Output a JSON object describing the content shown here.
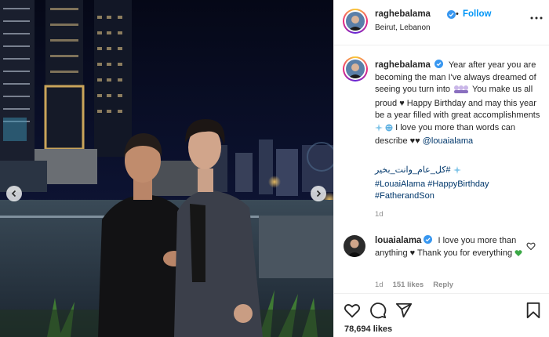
{
  "post": {
    "username": "raghebalama",
    "follow_label": "Follow",
    "separator": "•",
    "location": "Beirut, Lebanon"
  },
  "caption": {
    "username": "raghebalama",
    "text_1": "Year after year you are becoming the man I've always dreamed of seeing you turn into",
    "text_2": "You make us all proud",
    "text_3": "Happy Birthday and may this year be a year filled with great accomplishments",
    "text_4": "I love you more than words can describe",
    "mention": "@louaialama",
    "hashtags": [
      "#كل_عام_وانت_بخير",
      "#LouaiAlama",
      "#HappyBirthday",
      "#FatherandSon"
    ],
    "time": "1d"
  },
  "comment": {
    "username": "louaialama",
    "text_1": "I love you more than anything",
    "text_2": "Thank you for everything",
    "time": "1d",
    "likes": "151 likes",
    "reply_label": "Reply"
  },
  "footer": {
    "like_count": "78,694 likes"
  },
  "icons": {
    "verified": "verified-badge-icon",
    "more": "more-options-icon",
    "heart": "heart-icon",
    "comment": "comment-icon",
    "share": "share-icon",
    "save": "bookmark-icon",
    "prev": "chevron-left-icon",
    "next": "chevron-right-icon"
  },
  "colors": {
    "link": "#0095f6",
    "hashtag": "#00376b",
    "muted": "#8e8e8e",
    "verified": "#3897f0"
  }
}
